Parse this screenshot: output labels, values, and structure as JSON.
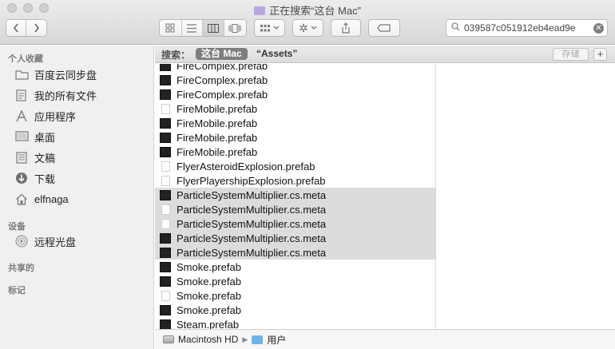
{
  "window": {
    "title": "正在搜索“这台 Mac”"
  },
  "toolbar": {
    "search_value": "039587c051912eb4ead9e",
    "search_placeholder": "搜索"
  },
  "sidebar": {
    "favorites_header": "个人收藏",
    "favorites": [
      {
        "label": "百度云同步盘",
        "icon": "folder-icon"
      },
      {
        "label": "我的所有文件",
        "icon": "all-files-icon"
      },
      {
        "label": "应用程序",
        "icon": "applications-icon"
      },
      {
        "label": "桌面",
        "icon": "desktop-icon"
      },
      {
        "label": "文稿",
        "icon": "documents-icon"
      },
      {
        "label": "下载",
        "icon": "downloads-icon"
      },
      {
        "label": "elfnaga",
        "icon": "home-icon"
      }
    ],
    "devices_header": "设备",
    "devices": [
      {
        "label": "远程光盘",
        "icon": "disc-icon"
      }
    ],
    "shared_header": "共享的",
    "tags_header": "标记"
  },
  "scope": {
    "label": "搜索：",
    "this_mac": "这台 Mac",
    "assets": "“Assets”",
    "save": "存储",
    "add": "+"
  },
  "files": [
    {
      "name": "FireComplex.prefab",
      "icon": "dark",
      "selected": false
    },
    {
      "name": "FireComplex.prefab",
      "icon": "dark",
      "selected": false
    },
    {
      "name": "FireComplex.prefab",
      "icon": "dark",
      "selected": false
    },
    {
      "name": "FireMobile.prefab",
      "icon": "doc",
      "selected": false
    },
    {
      "name": "FireMobile.prefab",
      "icon": "dark",
      "selected": false
    },
    {
      "name": "FireMobile.prefab",
      "icon": "dark",
      "selected": false
    },
    {
      "name": "FireMobile.prefab",
      "icon": "dark",
      "selected": false
    },
    {
      "name": "FlyerAsteroidExplosion.prefab",
      "icon": "doc",
      "selected": false
    },
    {
      "name": "FlyerPlayershipExplosion.prefab",
      "icon": "doc",
      "selected": false
    },
    {
      "name": "ParticleSystemMultiplier.cs.meta",
      "icon": "dark",
      "selected": true
    },
    {
      "name": "ParticleSystemMultiplier.cs.meta",
      "icon": "doc",
      "selected": true
    },
    {
      "name": "ParticleSystemMultiplier.cs.meta",
      "icon": "doc",
      "selected": true
    },
    {
      "name": "ParticleSystemMultiplier.cs.meta",
      "icon": "dark",
      "selected": true
    },
    {
      "name": "ParticleSystemMultiplier.cs.meta",
      "icon": "dark",
      "selected": true
    },
    {
      "name": "Smoke.prefab",
      "icon": "dark",
      "selected": false
    },
    {
      "name": "Smoke.prefab",
      "icon": "dark",
      "selected": false
    },
    {
      "name": "Smoke.prefab",
      "icon": "doc",
      "selected": false
    },
    {
      "name": "Smoke.prefab",
      "icon": "dark",
      "selected": false
    },
    {
      "name": "Steam.prefab",
      "icon": "dark",
      "selected": false
    }
  ],
  "pathbar": {
    "disk": "Macintosh HD",
    "folder": "用户"
  }
}
